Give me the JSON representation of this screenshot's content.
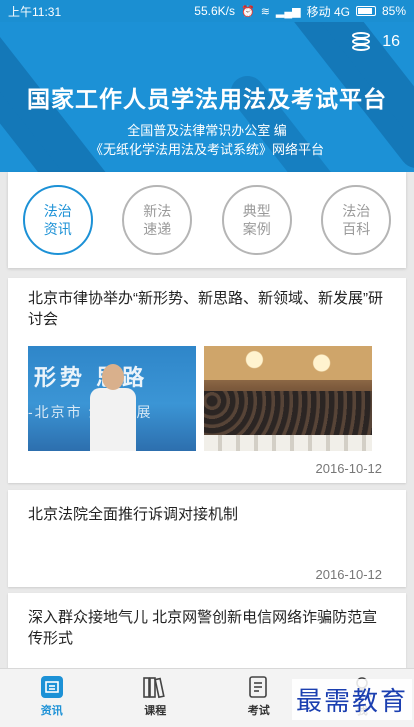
{
  "status_bar": {
    "time": "上午11:31",
    "net_speed": "55.6K/s",
    "network": "移动 4G",
    "battery": "85%"
  },
  "header": {
    "count": "16",
    "title": "国家工作人员学法用法及考试平台",
    "subtitle_line1": "全国普及法律常识办公室 编",
    "subtitle_line2": "《无纸化学法用法及考试系统》网络平台"
  },
  "categories": [
    {
      "label": "法治资讯",
      "active": true
    },
    {
      "label": "新法速递",
      "active": false
    },
    {
      "label": "典型案例",
      "active": false
    },
    {
      "label": "法治百科",
      "active": false
    }
  ],
  "news": [
    {
      "title": "北京市律协举办“新形势、新思路、新领域、新发展”研讨会",
      "date": "2016-10-12",
      "photo1_text": "形势 思路",
      "photo1_text2": "-北京市 企业发展"
    },
    {
      "title": "北京法院全面推行诉调对接机制",
      "date": "2016-10-12"
    },
    {
      "title": "深入群众接地气儿 北京网警创新电信网络诈骗防范宣传形式"
    }
  ],
  "bottom_nav": [
    {
      "label": "资讯",
      "icon": "news-icon",
      "active": true
    },
    {
      "label": "课程",
      "icon": "books-icon",
      "active": false
    },
    {
      "label": "考试",
      "icon": "exam-icon",
      "active": false
    },
    {
      "label": "我",
      "icon": "profile-icon",
      "active": false
    }
  ],
  "watermark": "最需教育",
  "colors": {
    "accent": "#1c91d6",
    "header_bg": "#1c91d6"
  }
}
